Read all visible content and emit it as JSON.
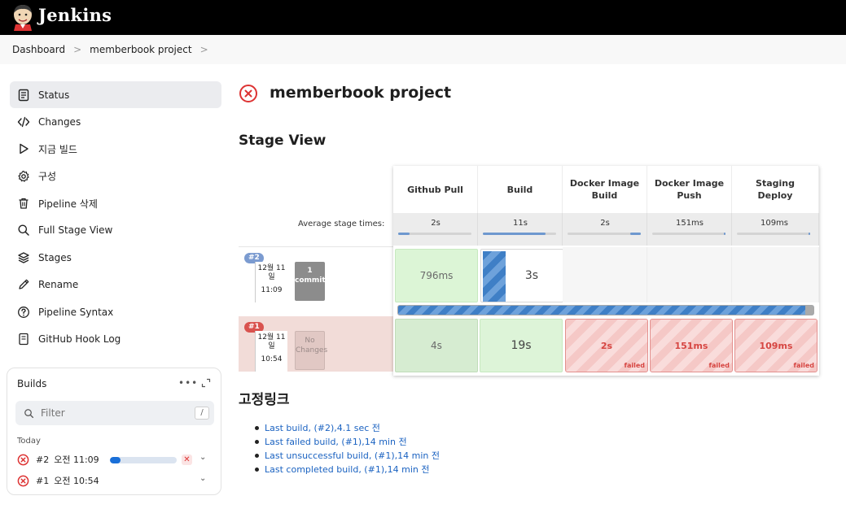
{
  "header": {
    "brand": "Jenkins"
  },
  "breadcrumb": {
    "items": [
      "Dashboard",
      "memberbook project"
    ],
    "separator": ">"
  },
  "sidebar": {
    "items": [
      {
        "label": "Status",
        "icon": "status-icon",
        "active": true
      },
      {
        "label": "Changes",
        "icon": "code-icon"
      },
      {
        "label": "지금 빌드",
        "icon": "play-icon"
      },
      {
        "label": "구성",
        "icon": "gear-icon"
      },
      {
        "label": "Pipeline 삭제",
        "icon": "trash-icon"
      },
      {
        "label": "Full Stage View",
        "icon": "search-icon"
      },
      {
        "label": "Stages",
        "icon": "layers-icon"
      },
      {
        "label": "Rename",
        "icon": "pencil-icon"
      },
      {
        "label": "Pipeline Syntax",
        "icon": "help-icon"
      },
      {
        "label": "GitHub Hook Log",
        "icon": "document-icon"
      }
    ]
  },
  "builds": {
    "title": "Builds",
    "more": "•••",
    "filter_placeholder": "Filter",
    "filter_shortcut": "/",
    "group": "Today",
    "rows": [
      {
        "num": "#2",
        "time": "오전 11:09",
        "status": "failed",
        "progress": 0.16,
        "abort": "✕"
      },
      {
        "num": "#1",
        "time": "오전 10:54",
        "status": "failed"
      }
    ]
  },
  "page": {
    "title": "memberbook project",
    "stage_view_title": "Stage View"
  },
  "stage_view": {
    "avg_label": "Average stage times:",
    "stages": [
      {
        "name": "Github Pull",
        "avg": "2s",
        "avg_fill": 0.15
      },
      {
        "name": "Build",
        "avg": "11s",
        "avg_fill": 0.85
      },
      {
        "name": "Docker Image Build",
        "avg": "2s",
        "avg_fill": 0.15
      },
      {
        "name": "Docker Image Push",
        "avg": "151ms",
        "avg_fill": 0.02
      },
      {
        "name": "Staging Deploy",
        "avg": "109ms",
        "avg_fill": 0.02
      }
    ],
    "runs": [
      {
        "badge": "#2",
        "date": "12월 11 일",
        "time": "11:09",
        "commit": "1 commit",
        "cells": [
          "796ms",
          "3s",
          "",
          "",
          ""
        ]
      },
      {
        "badge": "#1",
        "date": "12월 11 일",
        "time": "10:54",
        "commit": "No Changes",
        "cells": [
          "4s",
          "19s",
          "2s",
          "151ms",
          "109ms"
        ],
        "failed_tag": "failed"
      }
    ]
  },
  "permalinks": {
    "title": "고정링크",
    "items": [
      "Last build, (#2),4.1 sec 전",
      "Last failed build, (#1),14 min 전",
      "Last unsuccessful build, (#1),14 min 전",
      "Last completed build, (#1),14 min 전"
    ]
  },
  "colors": {
    "header_bg": "#000000",
    "fail_red": "#d64541",
    "success_green": "#dcf5d6",
    "link_blue": "#1a62c1"
  }
}
